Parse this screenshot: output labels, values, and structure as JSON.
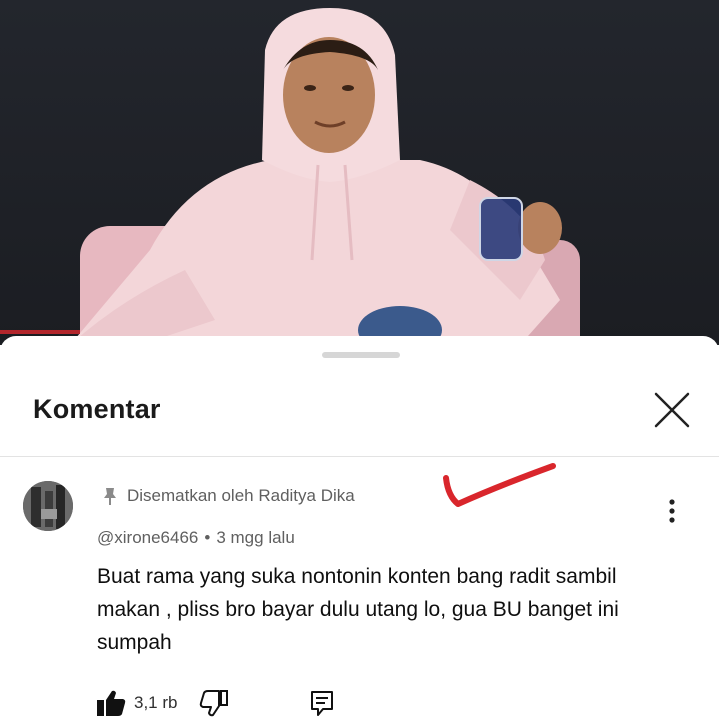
{
  "sheet": {
    "title": "Komentar"
  },
  "comment": {
    "pinned_label": "Disematkan oleh Raditya Dika",
    "author": "@xirone6466",
    "separator": "•",
    "time": "3 mgg lalu",
    "text": "Buat rama yang suka nontonin konten bang radit sambil makan , pliss bro bayar dulu utang lo, gua BU banget ini sumpah",
    "like_count": "3,1 rb"
  },
  "icons": {
    "close": "close-icon",
    "pin": "pin-icon",
    "more": "more-vert-icon",
    "like": "thumbs-up-icon",
    "dislike": "thumbs-down-icon",
    "reply": "reply-icon"
  },
  "colors": {
    "annotation_check": "#d9262c",
    "sheet_background": "#ffffff",
    "video_background": "#1f2126",
    "hoodie": "#f2d3d6"
  }
}
